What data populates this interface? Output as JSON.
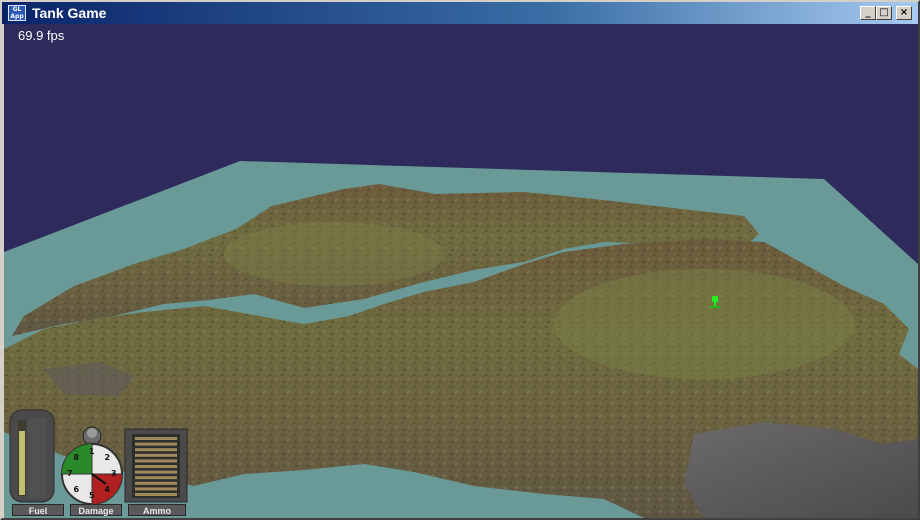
{
  "window": {
    "title": "Tank Game",
    "icon_text": "GL App",
    "controls": {
      "minimize": "_",
      "maximize": "□",
      "close": "×"
    }
  },
  "hud": {
    "fps": "69.9 fps",
    "fuel_label": "Fuel",
    "damage_label": "Damage",
    "ammo_label": "Ammo",
    "damage_dial_numbers": [
      "1",
      "2",
      "3",
      "4",
      "5",
      "6",
      "7",
      "8"
    ],
    "fuel_level": 0.85,
    "ammo_rounds": 11
  },
  "colors": {
    "sky": "#2e2b5c",
    "water": "#6a9a98",
    "terrain": "#6e6a3e",
    "rock": "#5c5a5c",
    "tank_marker": "#22ee22"
  }
}
